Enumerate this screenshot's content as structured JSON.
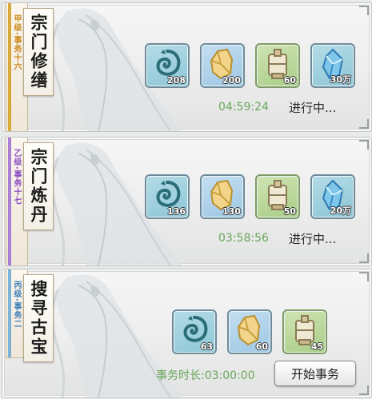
{
  "tasks": [
    {
      "grade": "甲级·事务十六",
      "grade_color": "#c98a1a",
      "strip_color": "#d7a83a",
      "title": "宗门修缮",
      "items": [
        {
          "icon": "swirl-orb-icon",
          "qty": "208"
        },
        {
          "icon": "gold-ore-icon",
          "qty": "200"
        },
        {
          "icon": "scroll-bundle-icon",
          "qty": "60"
        },
        {
          "icon": "blue-crystal-icon",
          "qty": "30万"
        }
      ],
      "timer": "04:59:24",
      "status": "进行中..."
    },
    {
      "grade": "乙级·事务十七",
      "grade_color": "#8a4cc2",
      "strip_color": "#a97fd6",
      "title": "宗门炼丹",
      "items": [
        {
          "icon": "swirl-orb-icon",
          "qty": "136"
        },
        {
          "icon": "gold-ore-icon",
          "qty": "130"
        },
        {
          "icon": "scroll-bundle-icon",
          "qty": "50"
        },
        {
          "icon": "blue-crystal-icon",
          "qty": "20万"
        }
      ],
      "timer": "03:58:56",
      "status": "进行中..."
    },
    {
      "grade": "丙级·事务二",
      "grade_color": "#3f7fb8",
      "strip_color": "#7db3d9",
      "title": "搜寻古宝",
      "items": [
        {
          "icon": "swirl-orb-icon",
          "qty": "63"
        },
        {
          "icon": "gold-ore-icon",
          "qty": "60"
        },
        {
          "icon": "scroll-bundle-icon",
          "qty": "45"
        }
      ],
      "duration_label": "事务时长:",
      "duration": "03:00:00",
      "button_label": "开始事务"
    }
  ]
}
